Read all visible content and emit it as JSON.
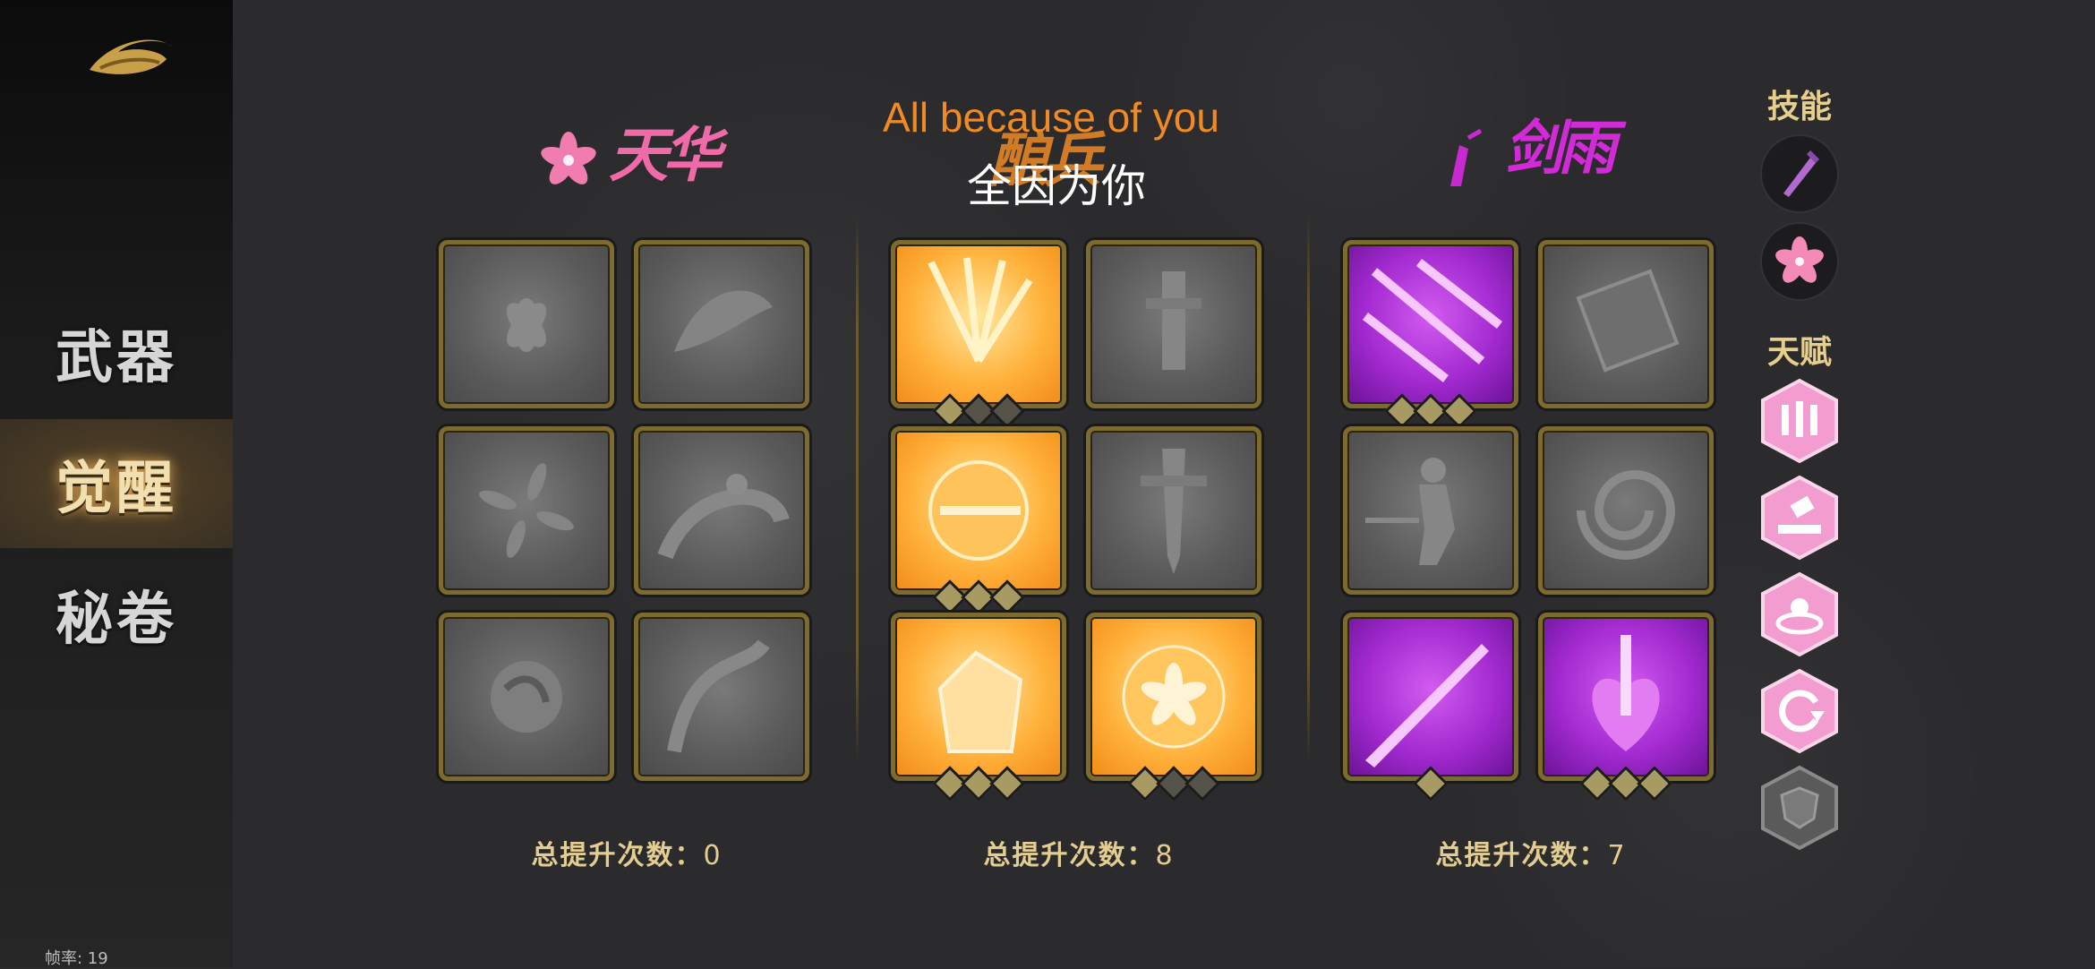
{
  "sidebar": {
    "items": [
      {
        "label": "武器"
      },
      {
        "label": "觉醒"
      },
      {
        "label": "秘卷"
      }
    ],
    "active_index": 1,
    "fps_text": "帧率: 19"
  },
  "lyrics": {
    "english": "All because of you",
    "chinese": "全因为你"
  },
  "columns": [
    {
      "title": "天华",
      "title_color": "#f06aa8",
      "total_label": "总提升次数：",
      "total_value": "0"
    },
    {
      "title": "酿兵",
      "title_color": "#f08a25",
      "total_label": "总提升次数：",
      "total_value": "8"
    },
    {
      "title": "剑雨",
      "title_color": "#d22ad6",
      "total_label": "总提升次数：",
      "total_value": "7"
    }
  ],
  "rightbar": {
    "skills_label": "技能",
    "talents_label": "天赋",
    "skills": [
      {
        "icon": "purple-dagger-icon"
      },
      {
        "icon": "pink-flower-icon"
      }
    ],
    "talents": [
      {
        "icon": "triple-sword-talent-icon",
        "state": "active"
      },
      {
        "icon": "hammer-talent-icon",
        "state": "active"
      },
      {
        "icon": "flower-plate-talent-icon",
        "state": "active"
      },
      {
        "icon": "spin-arrow-talent-icon",
        "state": "active"
      },
      {
        "icon": "shield-talent-icon",
        "state": "locked"
      }
    ]
  },
  "colors": {
    "accent_gold": "#e3cd91",
    "tile_border": "#7c6a2e",
    "orange": "#f5a02a",
    "purple": "#a22ad0",
    "pink": "#f06aa8"
  }
}
